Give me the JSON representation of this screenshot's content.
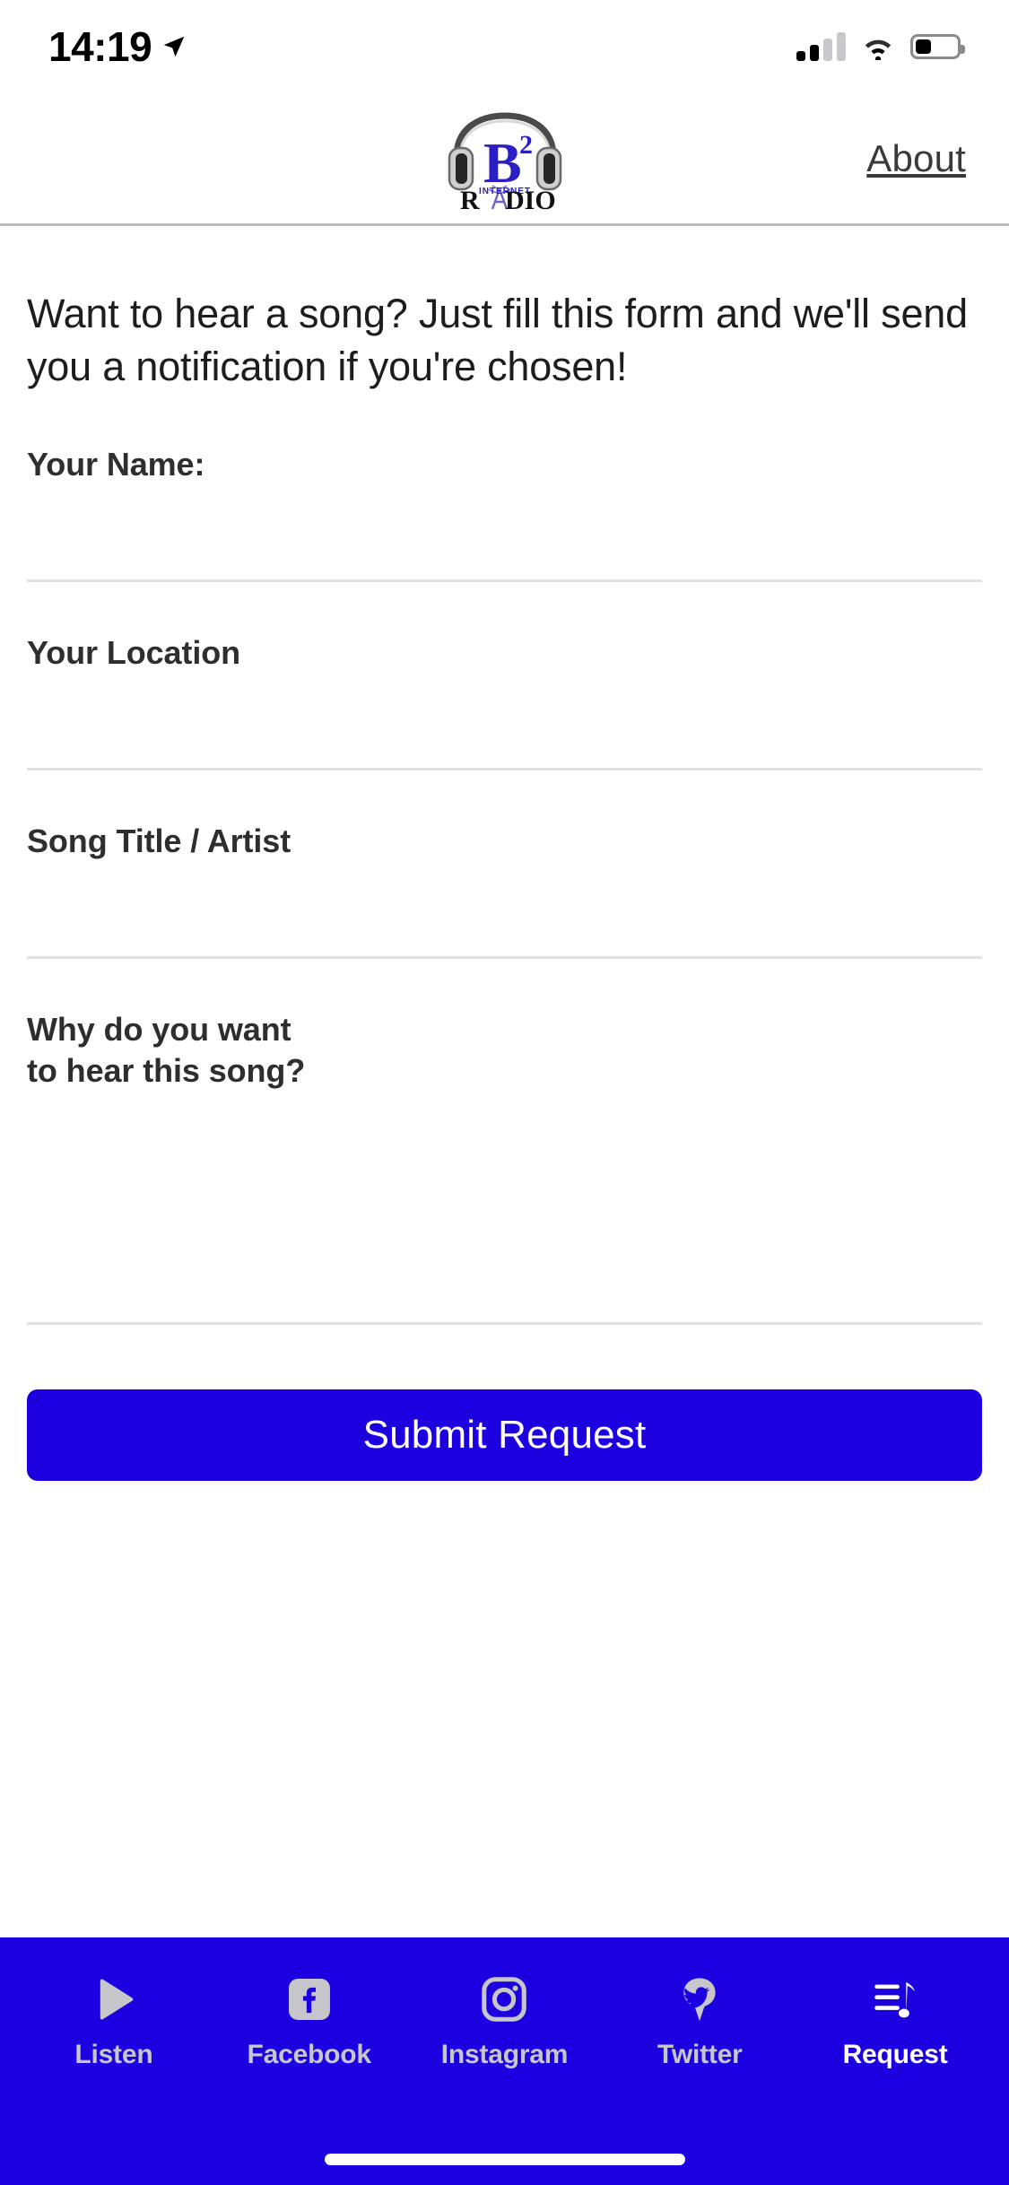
{
  "status_bar": {
    "time": "14:19",
    "location_icon": "location-arrow-icon",
    "signal_icon": "cellular-signal-icon",
    "signal_bars_filled": 2,
    "signal_bars_total": 4,
    "wifi_icon": "wifi-icon",
    "battery_icon": "battery-icon",
    "battery_percent": 38
  },
  "header": {
    "logo_alt": "B2 Internet Radio",
    "logo_letter": "B",
    "logo_exponent": "2",
    "logo_word": "RADIO",
    "logo_overlay": "INTERNET",
    "about_label": "About"
  },
  "main": {
    "intro": "Want to hear a song? Just fill this form and we'll send you a notification if you're chosen!",
    "fields": [
      {
        "label": "Your Name:",
        "value": "",
        "placeholder": "",
        "type": "text",
        "name": "your-name"
      },
      {
        "label": "Your Location",
        "value": "",
        "placeholder": "",
        "type": "text",
        "name": "your-location"
      },
      {
        "label": "Song Title / Artist",
        "value": "",
        "placeholder": "",
        "type": "text",
        "name": "song-title-artist"
      },
      {
        "label": "Why do you want\nto hear this song?",
        "value": "",
        "placeholder": "",
        "type": "textarea",
        "name": "why-hear-song"
      }
    ],
    "submit_label": "Submit Request"
  },
  "tab_bar": {
    "background_color": "#1c00e0",
    "active_color": "#ffffff",
    "inactive_color": "#c6c6cb",
    "active_index": 4,
    "tabs": [
      {
        "label": "Listen",
        "icon": "play-icon"
      },
      {
        "label": "Facebook",
        "icon": "facebook-icon"
      },
      {
        "label": "Instagram",
        "icon": "instagram-icon"
      },
      {
        "label": "Twitter",
        "icon": "twitter-pin-icon"
      },
      {
        "label": "Request",
        "icon": "playlist-music-note-icon"
      }
    ]
  },
  "colors": {
    "brand_blue": "#1c00e0",
    "logo_blue": "#2a1ec4",
    "text_dark": "#1d1d1f",
    "label_dark": "#2e2e2e",
    "divider": "#e2e2e2",
    "header_border": "#b9b9b9"
  }
}
